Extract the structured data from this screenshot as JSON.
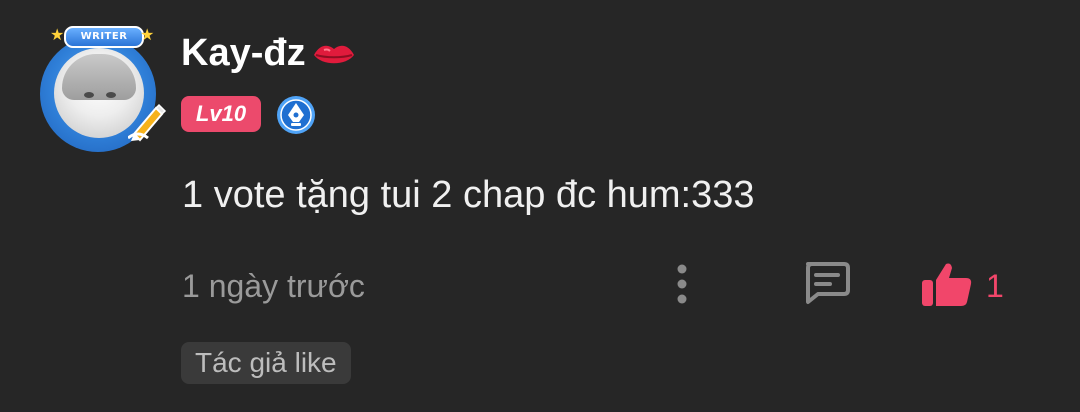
{
  "comment": {
    "author": {
      "name": "Kay-đz",
      "avatar_banner": "WRITER",
      "level": "Lv10",
      "badge_icon": "pen-nib-badge-icon",
      "name_emoji_icon": "lips-icon"
    },
    "text": "1 vote tặng tui 2 chap đc hum:333",
    "timestamp": "1 ngày trước",
    "actions": {
      "more_icon": "vertical-dots-icon",
      "reply_icon": "comment-bubble-icon",
      "like_icon": "thumbs-up-icon",
      "like_count": "1"
    },
    "author_liked_label": "Tác giả like"
  },
  "colors": {
    "background": "#262626",
    "accent": "#ec4a6c",
    "like": "#f1466a",
    "muted_text": "#9a9a9a",
    "badge_blue": "#2f7fd8"
  }
}
